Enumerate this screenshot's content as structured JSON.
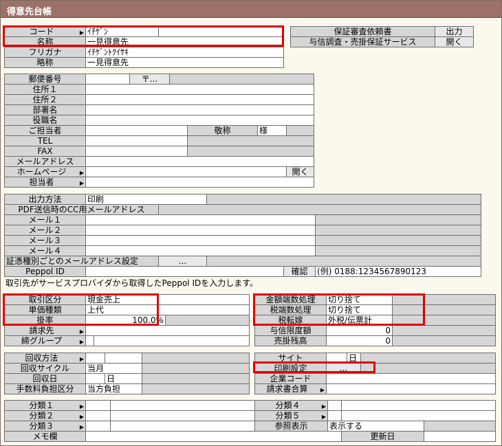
{
  "window": {
    "title": "得意先台帳"
  },
  "basic": {
    "code_label": "コード",
    "code_value": "ｲﾁｹﾞﾝ",
    "name_label": "名称",
    "name_value": "一見得意先",
    "furigana_label": "フリガナ",
    "furigana_value": "ｲﾁｹﾞﾝﾄｸｲｻｷ",
    "short_label": "略称",
    "short_value": "一見得意先"
  },
  "guarantee": {
    "request_label": "保証審査依頼書",
    "request_button": "出力",
    "survey_label": "与信調査・売掛保証サービス",
    "survey_button": "開く"
  },
  "address": {
    "postal_label": "郵便番号",
    "postal_button": "〒...",
    "addr1_label": "住所１",
    "addr2_label": "住所２",
    "dept_label": "部署名",
    "title_label": "役職名",
    "contact_label": "ご担当者",
    "honorific_label": "敬称",
    "honorific_value": "様",
    "tel_label": "TEL",
    "fax_label": "FAX",
    "mail_label": "メールアドレス",
    "homepage_label": "ホームページ",
    "homepage_button": "開く",
    "staff_label": "担当者"
  },
  "output": {
    "method_label": "出力方法",
    "method_value": "印刷",
    "pdf_cc_label": "PDF送信時のCC用メールアドレス",
    "mail1_label": "メール１",
    "mail2_label": "メール２",
    "mail3_label": "メール３",
    "mail4_label": "メール４",
    "cert_label": "証憑種別ごとのメールアドレス設定",
    "cert_button": "...",
    "peppol_label": "Peppol ID",
    "confirm_label": "確認",
    "peppol_example": "(例) 0188:1234567890123",
    "peppol_note": "取引先がサービスプロバイダから取得したPeppol IDを入力します。"
  },
  "trade": {
    "type_label": "取引区分",
    "type_value": "現金売上",
    "price_label": "単価種類",
    "price_value": "上代",
    "rate_label": "掛率",
    "rate_value": "100.0",
    "rate_unit": "%",
    "billing_label": "請求先",
    "group_label": "締グループ",
    "rounding_label": "金額端数処理",
    "rounding_value": "切り捨て",
    "tax_rounding_label": "税端数処理",
    "tax_rounding_value": "切り捨て",
    "tax_shift_label": "税転嫁",
    "tax_shift_value": "外税/伝票計",
    "credit_label": "与信限度額",
    "credit_value": "0",
    "balance_label": "売掛残高",
    "balance_value": "0"
  },
  "collection": {
    "method_label": "回収方法",
    "cycle_label": "回収サイクル",
    "cycle_value": "当月",
    "day_label": "回収日",
    "day_value": "日",
    "fee_label": "手数料負担区分",
    "fee_value": "当方負担",
    "site_label": "サイト",
    "site_value": "日",
    "print_label": "印刷設定",
    "print_button": "...",
    "company_label": "企業コード",
    "invoice_label": "請求書合算"
  },
  "classification": {
    "class1": "分類１",
    "class2": "分類２",
    "class3": "分類３",
    "class4": "分類４",
    "class5": "分類５",
    "ref_label": "参照表示",
    "ref_value": "表示する",
    "memo_label": "メモ欄",
    "updated_label": "更新日"
  },
  "colors": {
    "titlebar": "#9c7168",
    "highlight": "#e00000",
    "background": "#fbf8ee"
  }
}
